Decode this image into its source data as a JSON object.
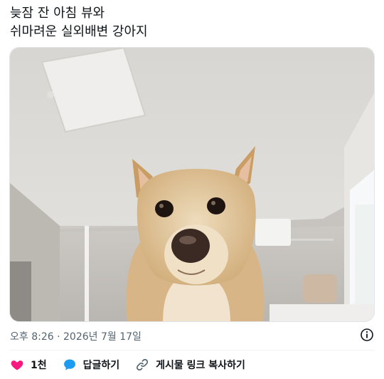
{
  "tweet": {
    "lines": [
      "늦잠 잔 아침 뷰와",
      "쉬마려운 실외배변 강아지"
    ]
  },
  "media": {
    "icon": "photo-of-dog"
  },
  "meta": {
    "timestamp": "오후 8:26 · 2026년 7월 17일",
    "info_icon": "info-circle-icon"
  },
  "actions": {
    "like_count": "1천",
    "reply_label": "답글하기",
    "copy_link_label": "게시물 링크 복사하기"
  },
  "colors": {
    "like": "#f91880",
    "reply": "#1d9bf0",
    "text_secondary": "#536471"
  }
}
